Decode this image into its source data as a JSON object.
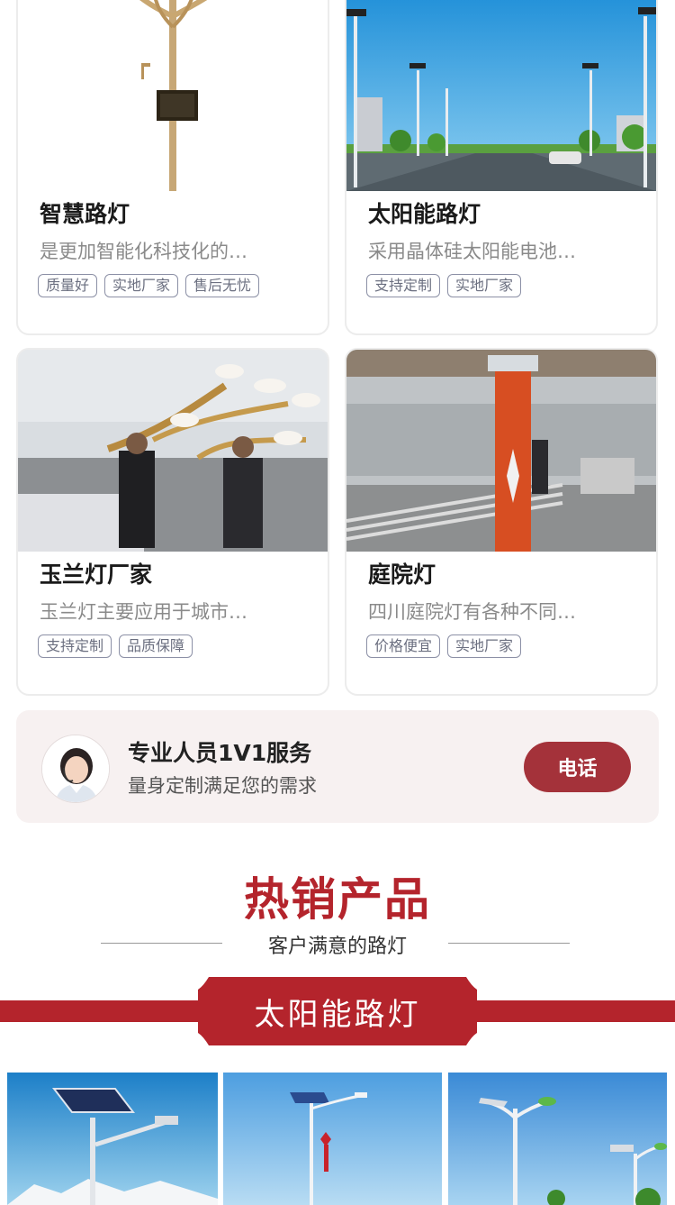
{
  "cards": [
    {
      "title": "智慧路灯",
      "desc": "是更加智能化科技化的…",
      "tags": [
        "质量好",
        "实地厂家",
        "售后无忧"
      ]
    },
    {
      "title": "太阳能路灯",
      "desc": "采用晶体硅太阳能电池…",
      "tags": [
        "支持定制",
        "实地厂家"
      ]
    },
    {
      "title": "玉兰灯厂家",
      "desc": "玉兰灯主要应用于城市…",
      "tags": [
        "支持定制",
        "品质保障"
      ]
    },
    {
      "title": "庭院灯",
      "desc": "四川庭院灯有各种不同…",
      "tags": [
        "价格便宜",
        "实地厂家"
      ]
    }
  ],
  "service": {
    "title": "专业人员1V1服务",
    "subtitle": "量身定制满足您的需求",
    "call_label": "电话"
  },
  "hot": {
    "title": "热销产品",
    "subtitle": "客户满意的路灯",
    "category": "太阳能路灯"
  },
  "colors": {
    "brand": "#b4242c",
    "button": "#a4323a",
    "tag_border": "#8c90a6"
  },
  "icons": [
    "agent-avatar",
    "smart-streetlight-photo",
    "solar-road-photo",
    "magnolia-lamp-photo",
    "courtyard-lamp-photo"
  ]
}
